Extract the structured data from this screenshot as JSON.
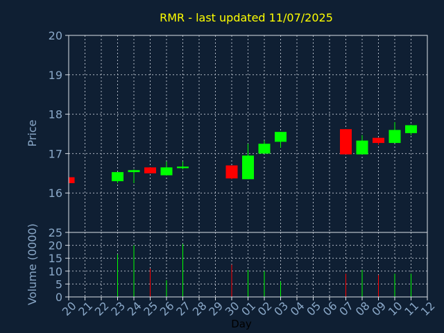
{
  "chart_data": {
    "type": "candlestick",
    "title": "RMR - last updated 11/07/2025",
    "xlabel": "Day",
    "price_panel": {
      "ylabel": "Price",
      "ylim": [
        15.0,
        20.0
      ],
      "yticks": [
        "16",
        "17",
        "18",
        "19",
        "20"
      ]
    },
    "volume_panel": {
      "ylabel": "Volume (0000)",
      "ylim": [
        0,
        25
      ],
      "yticks": [
        "0",
        "5",
        "10",
        "15",
        "20",
        "25"
      ]
    },
    "x_ticks": [
      "20",
      "21",
      "22",
      "23",
      "24",
      "25",
      "26",
      "27",
      "28",
      "29",
      "30",
      "01",
      "02",
      "03",
      "04",
      "05",
      "06",
      "07",
      "08",
      "09",
      "10",
      "11",
      "12"
    ],
    "candles": [
      {
        "day": "20",
        "open": 16.4,
        "high": 16.4,
        "low": 16.25,
        "close": 16.25,
        "volume": 0
      },
      {
        "day": "23",
        "open": 16.3,
        "high": 16.53,
        "low": 16.25,
        "close": 16.53,
        "volume": 16.5
      },
      {
        "day": "24",
        "open": 16.53,
        "high": 16.6,
        "low": 16.25,
        "close": 16.58,
        "volume": 20.0
      },
      {
        "day": "25",
        "open": 16.65,
        "high": 16.65,
        "low": 16.5,
        "close": 16.5,
        "volume": 11.0
      },
      {
        "day": "26",
        "open": 16.45,
        "high": 16.8,
        "low": 16.45,
        "close": 16.65,
        "volume": 6.5
      },
      {
        "day": "27",
        "open": 16.63,
        "high": 16.8,
        "low": 16.6,
        "close": 16.67,
        "volume": 20.5
      },
      {
        "day": "30",
        "open": 16.7,
        "high": 16.7,
        "low": 16.35,
        "close": 16.37,
        "volume": 12.5
      },
      {
        "day": "01",
        "open": 16.35,
        "high": 17.25,
        "low": 16.35,
        "close": 16.95,
        "volume": 10.5
      },
      {
        "day": "02",
        "open": 17.0,
        "high": 17.33,
        "low": 17.0,
        "close": 17.25,
        "volume": 10.0
      },
      {
        "day": "03",
        "open": 17.3,
        "high": 17.55,
        "low": 17.15,
        "close": 17.55,
        "volume": 6.0
      },
      {
        "day": "07",
        "open": 17.62,
        "high": 17.62,
        "low": 16.98,
        "close": 16.98,
        "volume": 9.0
      },
      {
        "day": "08",
        "open": 16.98,
        "high": 17.47,
        "low": 16.98,
        "close": 17.33,
        "volume": 10.5
      },
      {
        "day": "09",
        "open": 17.4,
        "high": 17.4,
        "low": 17.22,
        "close": 17.27,
        "volume": 8.5
      },
      {
        "day": "10",
        "open": 17.27,
        "high": 17.8,
        "low": 17.27,
        "close": 17.6,
        "volume": 9.0
      },
      {
        "day": "11",
        "open": 17.52,
        "high": 17.73,
        "low": 17.47,
        "close": 17.72,
        "volume": 9.0
      }
    ],
    "colors": {
      "background": "#0f1f33",
      "panel": "#0f1f33",
      "axis_text": "#8aa8c8",
      "title_text": "#ffff00",
      "grid": "#b0b8c4",
      "up": "#00ff00",
      "down": "#ff0000",
      "frame": "#dde3ea"
    },
    "grid": true
  }
}
